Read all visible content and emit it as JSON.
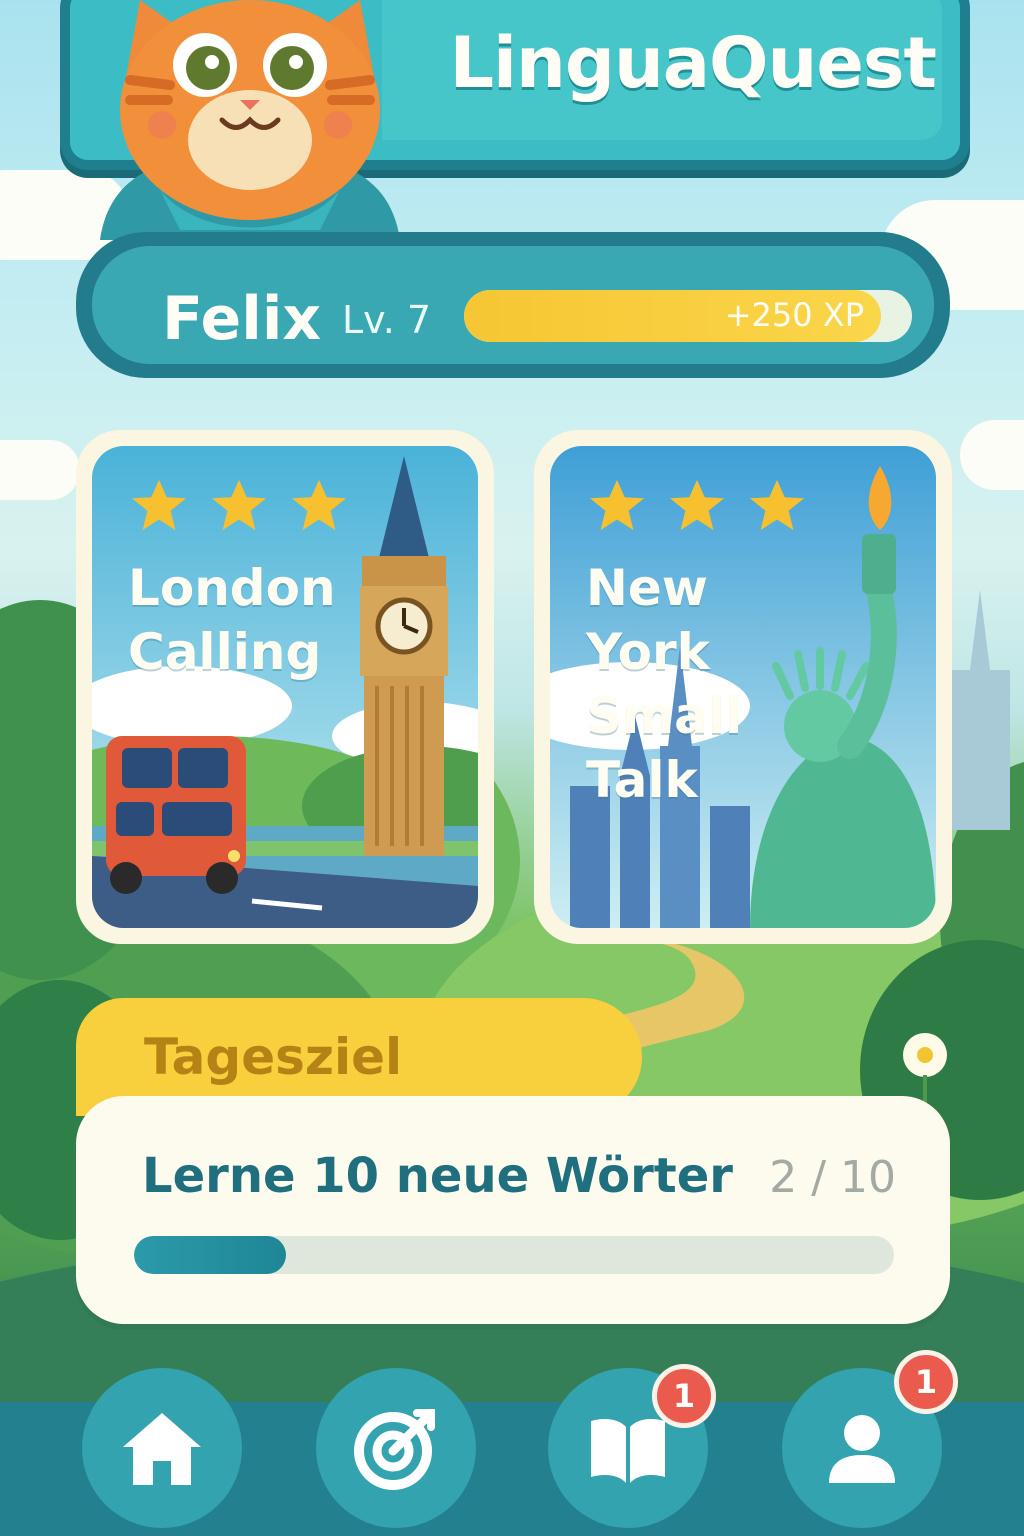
{
  "app": {
    "title": "LinguaQuest"
  },
  "player": {
    "name": "Felix",
    "level_label": "Lv. 7",
    "xp_label": "+250 XP",
    "xp_progress": 0.93
  },
  "lessons": [
    {
      "title_line1": "London",
      "title_line2": "Calling",
      "stars": 3,
      "icon": "big-ben-icon"
    },
    {
      "title_line1": "New York",
      "title_line2": "Small Talk",
      "stars": 3,
      "icon": "statue-of-liberty-icon"
    }
  ],
  "daily_goal": {
    "tab_label": "Tagesziel",
    "text": "Lerne 10 neue Wörter",
    "count_label": "2 / 10",
    "progress": 0.2
  },
  "nav": {
    "items": [
      {
        "icon": "home-icon",
        "badge": ""
      },
      {
        "icon": "target-icon",
        "badge": ""
      },
      {
        "icon": "book-icon",
        "badge": "1"
      },
      {
        "icon": "profile-icon",
        "badge": "1"
      }
    ]
  },
  "colors": {
    "teal_dark": "#237c8c",
    "teal": "#3cbcc4",
    "yellow": "#f8cf3c",
    "badge_red": "#ea5b4e",
    "cream": "#fdfbee"
  }
}
